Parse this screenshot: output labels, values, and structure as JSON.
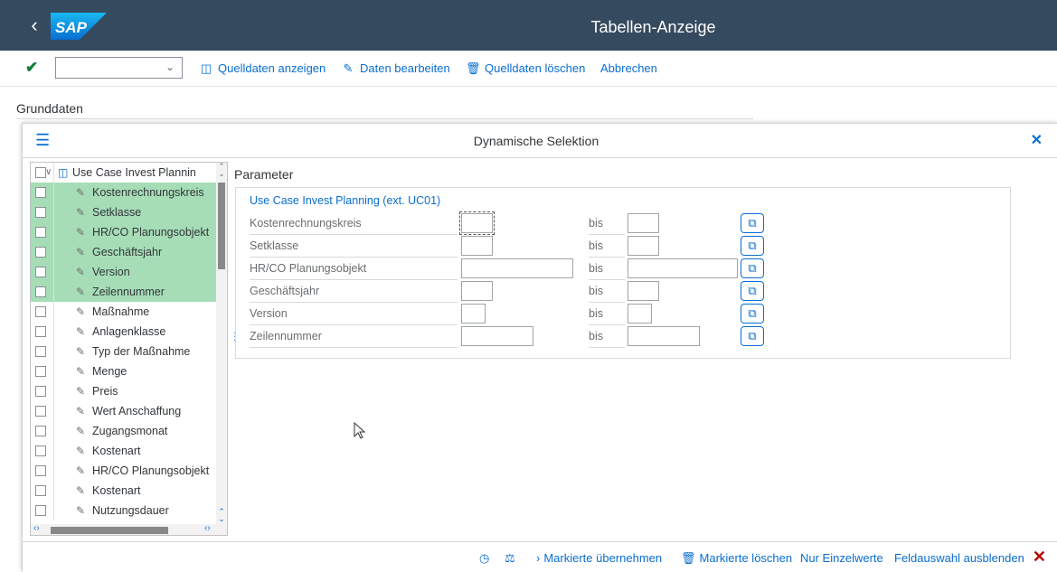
{
  "shell": {
    "back_icon": "chevron-left-icon",
    "logo": "SAP",
    "title": "Tabellen-Anzeige"
  },
  "toolbar": {
    "variant_value": "",
    "buttons": [
      {
        "label": "Quelldaten anzeigen",
        "icon": "display-source-icon"
      },
      {
        "label": "Daten bearbeiten",
        "icon": "edit-icon"
      },
      {
        "label": "Quelldaten löschen",
        "icon": "delete-icon"
      },
      {
        "label": "Abbrechen",
        "icon": ""
      }
    ]
  },
  "background": {
    "section_title": "Grunddaten"
  },
  "dialog": {
    "title": "Dynamische Selektion",
    "tree": {
      "root": "Use Case Invest Plannin",
      "items": [
        {
          "label": "Kostenrechnungskreis",
          "selected": true
        },
        {
          "label": "Setklasse",
          "selected": true
        },
        {
          "label": "HR/CO Planungsobjekt",
          "selected": true
        },
        {
          "label": "Geschäftsjahr",
          "selected": true
        },
        {
          "label": "Version",
          "selected": true
        },
        {
          "label": "Zeilennummer",
          "selected": true
        },
        {
          "label": "Maßnahme",
          "selected": false
        },
        {
          "label": "Anlagenklasse",
          "selected": false
        },
        {
          "label": "Typ der Maßnahme",
          "selected": false
        },
        {
          "label": "Menge",
          "selected": false
        },
        {
          "label": "Preis",
          "selected": false
        },
        {
          "label": "Wert Anschaffung",
          "selected": false
        },
        {
          "label": "Zugangsmonat",
          "selected": false
        },
        {
          "label": "Kostenart",
          "selected": false
        },
        {
          "label": "HR/CO Planungsobjekt",
          "selected": false
        },
        {
          "label": "Kostenart",
          "selected": false
        },
        {
          "label": "Nutzungsdauer",
          "selected": false
        }
      ]
    },
    "parameter": {
      "title": "Parameter",
      "group": "Use Case Invest Planning (ext. UC01)",
      "rows": [
        {
          "label": "Kostenrechnungskreis",
          "bis": "bis",
          "from": "",
          "to": ""
        },
        {
          "label": "Setklasse",
          "bis": "bis",
          "from": "",
          "to": ""
        },
        {
          "label": "HR/CO Planungsobjekt",
          "bis": "bis",
          "from": "",
          "to": ""
        },
        {
          "label": "Geschäftsjahr",
          "bis": "bis",
          "from": "",
          "to": ""
        },
        {
          "label": "Version",
          "bis": "bis",
          "from": "",
          "to": ""
        },
        {
          "label": "Zeilennummer",
          "bis": "bis",
          "from": "",
          "to": ""
        }
      ]
    },
    "footer": {
      "buttons": [
        {
          "label": "Markierte übernehmen"
        },
        {
          "label": "Markierte löschen"
        },
        {
          "label": "Nur Einzelwerte"
        },
        {
          "label": "Feldauswahl ausblenden"
        }
      ]
    }
  },
  "colors": {
    "shell": "#354a5f",
    "accent": "#0a6ed1",
    "selected_row": "#a6ddb7",
    "close": "#bb0000"
  }
}
